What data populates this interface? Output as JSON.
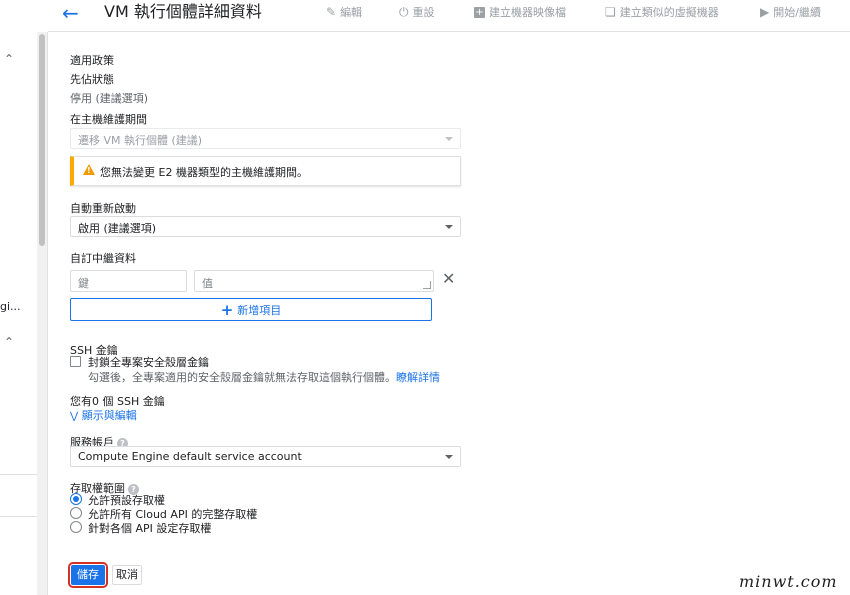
{
  "header": {
    "title": "VM 執行個體詳細資料",
    "edit": "編輯",
    "reset": "重設",
    "create_image": "建立機器映像檔",
    "create_similar": "建立類似的虛擬機器",
    "start": "開始/繼續"
  },
  "leftnav": {
    "truncated_label": "gi..."
  },
  "policy": {
    "heading": "適用政策",
    "preemptible_label": "先佔狀態",
    "preemptible_value": "停用 (建議選項)"
  },
  "maintenance": {
    "label": "在主機維護期間",
    "value": "遷移 VM 執行個體 (建議)",
    "warning": "您無法變更 E2 機器類型的主機維護期間。"
  },
  "restart": {
    "label": "自動重新啟動",
    "value": "啟用 (建議選項)"
  },
  "metadata": {
    "label": "自訂中繼資料",
    "key_placeholder": "鍵",
    "value_placeholder": "值",
    "add_label": "新增項目"
  },
  "ssh": {
    "label": "SSH 金鑰",
    "block_label": "封鎖全專案安全殼層金鑰",
    "block_desc": "勾選後，全專案適用的安全殼層金鑰就無法存取這個執行個體。",
    "learn_more": "瞭解詳情",
    "count_label": "您有0 個 SSH 金鑰",
    "show_edit": "顯示與編輯"
  },
  "service_account": {
    "label": "服務帳戶",
    "value": "Compute Engine default service account"
  },
  "scopes": {
    "label": "存取權範圍",
    "options": [
      "允許預設存取權",
      "允許所有 Cloud API 的完整存取權",
      "針對各個 API 設定存取權"
    ],
    "selected_index": 0
  },
  "footer": {
    "save": "儲存",
    "cancel": "取消"
  },
  "watermark": "minwt.com",
  "colors": {
    "accent": "#1a73e8",
    "warning": "#f9ab00",
    "highlight": "#d93025"
  }
}
